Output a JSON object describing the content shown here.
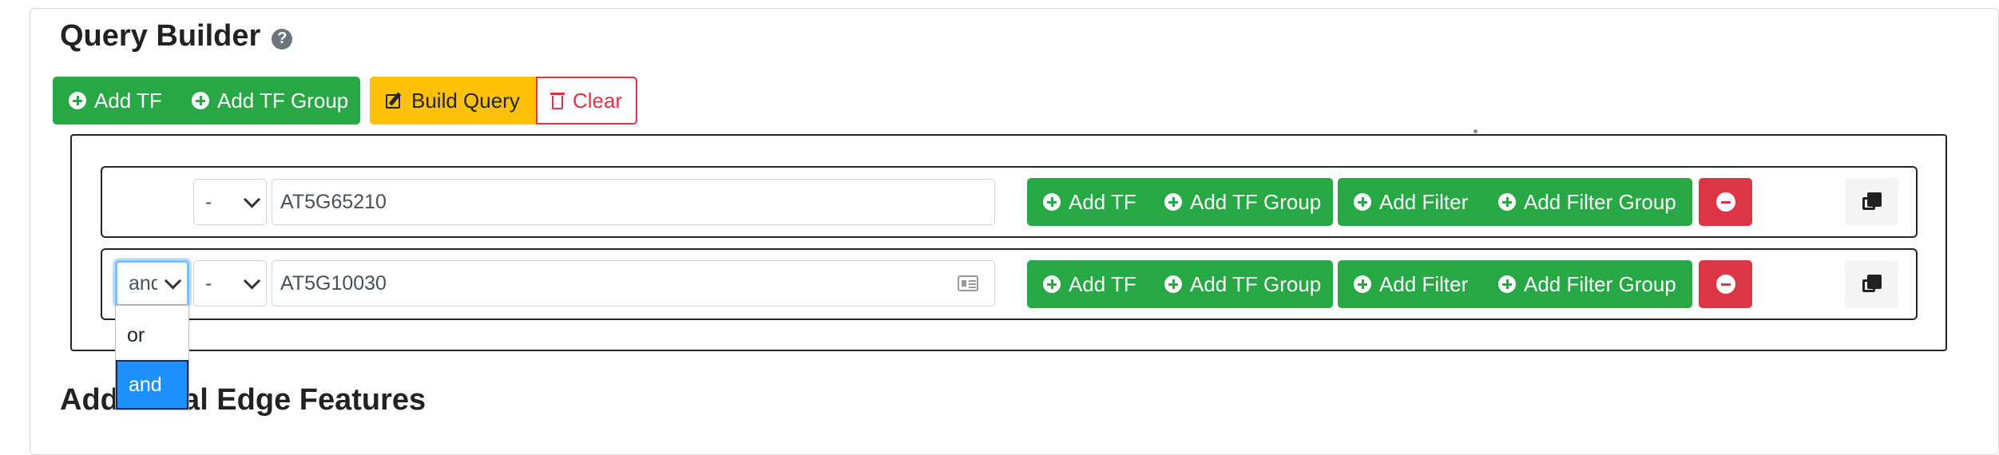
{
  "header": {
    "title": "Query Builder",
    "help_icon": "question-circle-icon"
  },
  "toolbar": {
    "add_tf": "Add TF",
    "add_tf_group": "Add TF Group",
    "build_query": "Build Query",
    "clear": "Clear"
  },
  "rows": [
    {
      "operator": "",
      "modifier": "-",
      "value": "AT5G65210"
    },
    {
      "operator": "and",
      "modifier": "-",
      "value": "AT5G10030"
    }
  ],
  "row_actions": {
    "add_tf": "Add TF",
    "add_tf_group": "Add TF Group",
    "add_filter": "Add Filter",
    "add_filter_group": "Add Filter Group"
  },
  "operator_dropdown": {
    "options": [
      "or",
      "and"
    ],
    "selected": "and"
  },
  "section": {
    "title": "Additional Edge Features"
  },
  "colors": {
    "success": "#28a745",
    "warning": "#ffc107",
    "danger": "#dc3545",
    "selected_option": "#1e90ff"
  }
}
